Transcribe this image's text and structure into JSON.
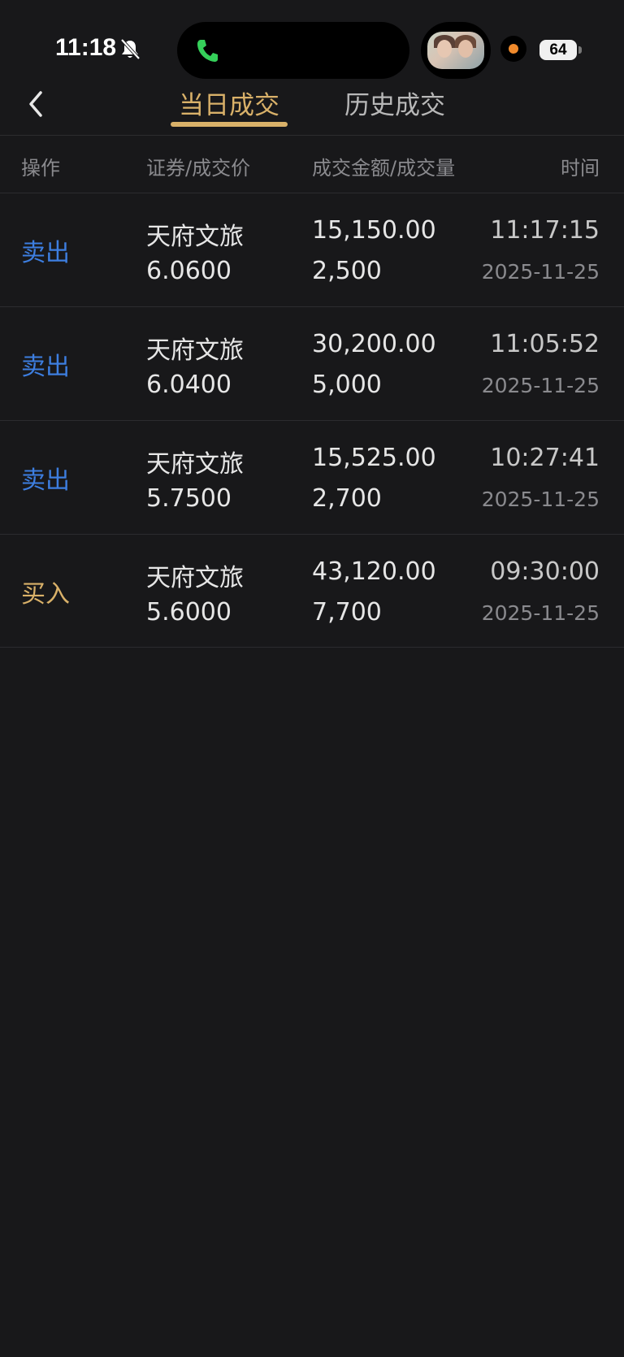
{
  "status_bar": {
    "time": "11:18",
    "battery": "64"
  },
  "tabs": [
    {
      "label": "当日成交",
      "active": true
    },
    {
      "label": "历史成交",
      "active": false
    }
  ],
  "table": {
    "headers": {
      "operation": "操作",
      "security_price": "证券/成交价",
      "amount_volume": "成交金额/成交量",
      "time": "时间"
    },
    "rows": [
      {
        "action": "卖出",
        "type": "sell",
        "name": "天府文旅",
        "price": "6.0600",
        "amount": "15,150.00",
        "volume": "2,500",
        "time": "11:17:15",
        "date": "2025-11-25"
      },
      {
        "action": "卖出",
        "type": "sell",
        "name": "天府文旅",
        "price": "6.0400",
        "amount": "30,200.00",
        "volume": "5,000",
        "time": "11:05:52",
        "date": "2025-11-25"
      },
      {
        "action": "卖出",
        "type": "sell",
        "name": "天府文旅",
        "price": "5.7500",
        "amount": "15,525.00",
        "volume": "2,700",
        "time": "10:27:41",
        "date": "2025-11-25"
      },
      {
        "action": "买入",
        "type": "buy",
        "name": "天府文旅",
        "price": "5.6000",
        "amount": "43,120.00",
        "volume": "7,700",
        "time": "09:30:00",
        "date": "2025-11-25"
      }
    ]
  },
  "colors": {
    "accent": "#d9b169",
    "sell": "#3d7ee0",
    "buy": "#d9b169",
    "background": "#18181a"
  }
}
